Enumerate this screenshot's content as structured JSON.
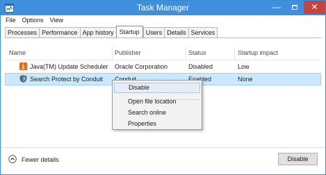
{
  "window": {
    "title": "Task Manager",
    "controls": {
      "minimize": "—",
      "close": "✕"
    },
    "accent_color": "#3f8fdd",
    "close_color": "#c7443b"
  },
  "menu": [
    "File",
    "Options",
    "View"
  ],
  "tabs": [
    {
      "label": "Processes",
      "active": false
    },
    {
      "label": "Performance",
      "active": false
    },
    {
      "label": "App history",
      "active": false
    },
    {
      "label": "Startup",
      "active": true
    },
    {
      "label": "Users",
      "active": false
    },
    {
      "label": "Details",
      "active": false
    },
    {
      "label": "Services",
      "active": false
    }
  ],
  "table": {
    "columns": [
      "Name",
      "Publisher",
      "Status",
      "Startup impact"
    ],
    "rows": [
      {
        "icon": "java-icon",
        "name": "Java(TM) Update Scheduler",
        "publisher": "Oracle Corporation",
        "status": "Disabled",
        "impact": "Low",
        "selected": false
      },
      {
        "icon": "shield-icon",
        "name": "Search Protect by Conduit",
        "publisher": "Conduit",
        "status": "Enabled",
        "impact": "None",
        "selected": true
      }
    ]
  },
  "context_menu": {
    "items": [
      {
        "label": "Disable",
        "highlighted": true
      },
      {
        "label": "Open file location",
        "highlighted": false
      },
      {
        "label": "Search online",
        "highlighted": false
      },
      {
        "label": "Properties",
        "highlighted": false
      }
    ]
  },
  "footer": {
    "toggle_label": "Fewer details",
    "action_button": "Disable"
  },
  "colors": {
    "selection_bg": "#cce8ff",
    "selection_border": "#99d1ff"
  }
}
